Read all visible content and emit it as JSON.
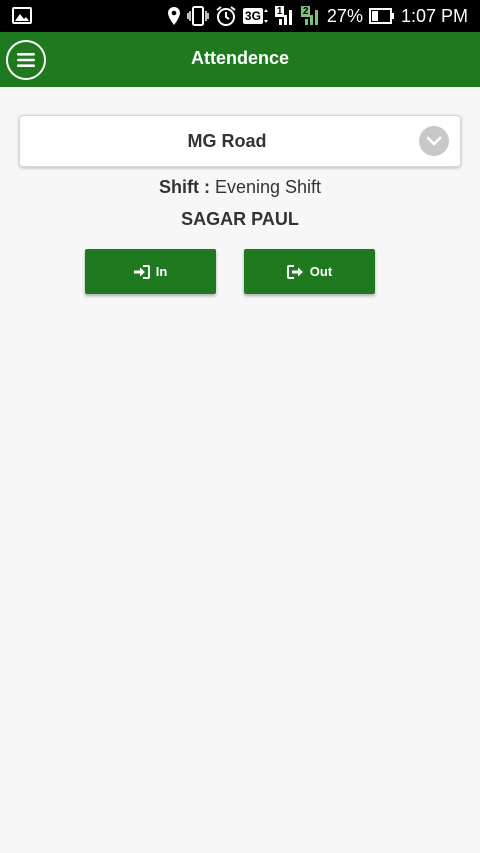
{
  "status_bar": {
    "network": "3G",
    "battery": "27%",
    "time": "1:07 PM",
    "sim1": "1",
    "sim2": "2"
  },
  "app_bar": {
    "title": "Attendence"
  },
  "location": {
    "selected": "MG Road"
  },
  "shift": {
    "label": "Shift :",
    "value": "Evening Shift"
  },
  "employee": {
    "name": "SAGAR PAUL"
  },
  "actions": {
    "in_label": "In",
    "out_label": "Out"
  },
  "colors": {
    "primary_green": "#1f7a1f",
    "background": "#f7f7f7"
  }
}
